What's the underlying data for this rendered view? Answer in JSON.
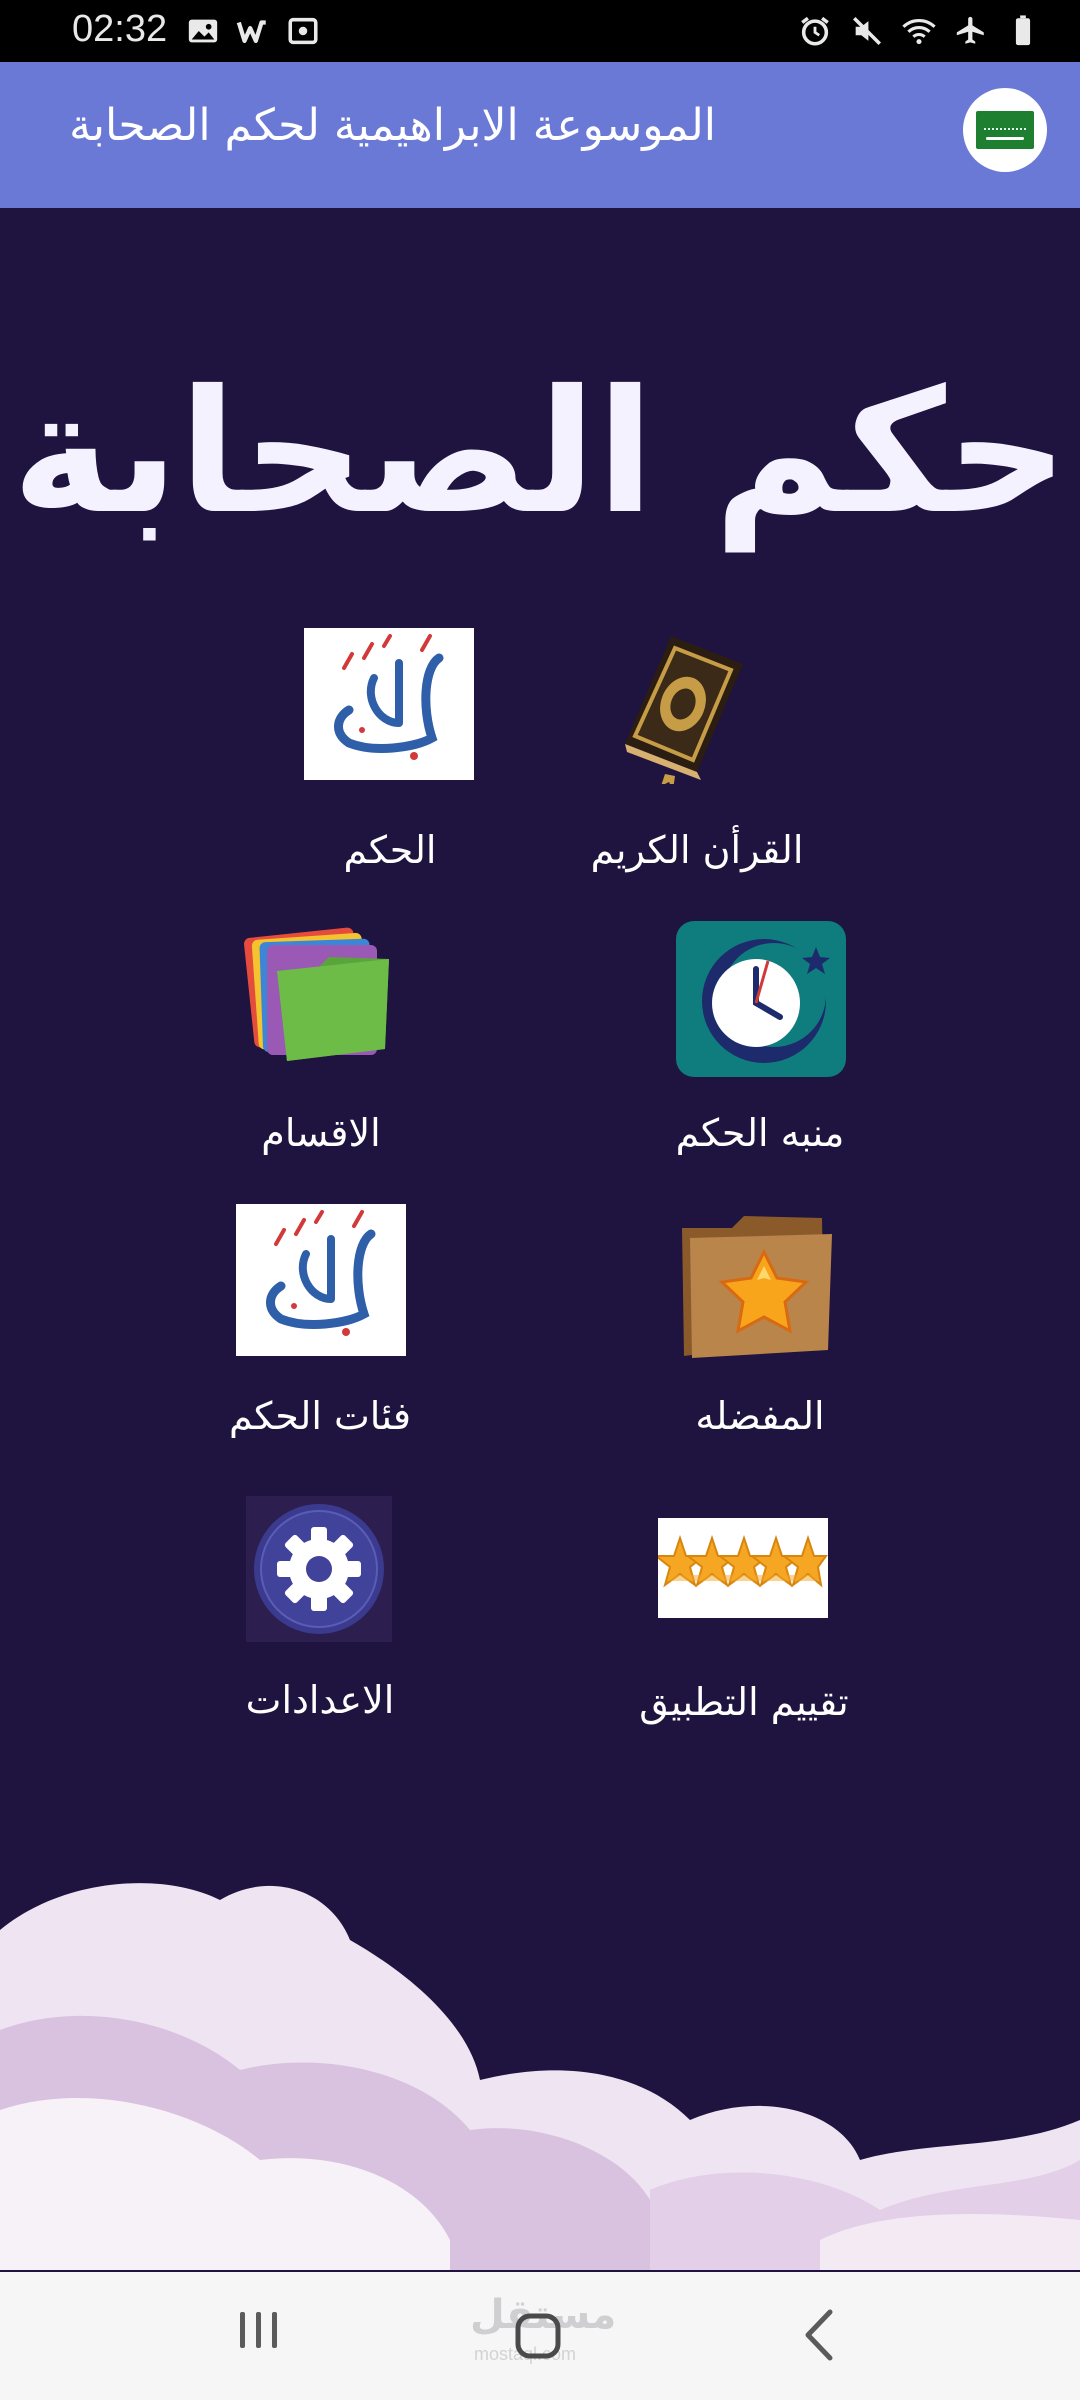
{
  "status_bar": {
    "time": "02:32",
    "left_icons": [
      "image-icon",
      "w-app-icon",
      "cast-icon"
    ],
    "right_icons": [
      "alarm-icon",
      "mute-icon",
      "wifi-icon",
      "airplane-icon",
      "battery-icon"
    ]
  },
  "app_bar": {
    "title": "الموسوعة الابراهيمية لحكم الصحابة",
    "avatar_icon": "saudi-flag-icon"
  },
  "hero": {
    "title": "حكم الصحابة"
  },
  "menu": {
    "items": [
      {
        "label": "الحكم",
        "icon": "calligraphy-icon"
      },
      {
        "label": "القرأن الكريم",
        "icon": "quran-book-icon"
      },
      {
        "label": "الاقسام",
        "icon": "folders-icon"
      },
      {
        "label": "منبه الحكم",
        "icon": "clock-crescent-icon"
      },
      {
        "label": "فئات الحكم",
        "icon": "calligraphy-icon"
      },
      {
        "label": "المفضله",
        "icon": "star-folder-icon"
      },
      {
        "label": "الاعدادات",
        "icon": "gear-icon"
      },
      {
        "label": "تقييم التطبيق",
        "icon": "stars-rating-icon"
      }
    ]
  },
  "nav_bar": {
    "watermark": "مستقل",
    "watermark_sub": "mostaql.com",
    "icons": [
      "recents-icon",
      "home-icon",
      "back-icon"
    ]
  },
  "colors": {
    "background": "#1f1340",
    "app_bar": "#6b79d6",
    "status_bar": "#000000",
    "nav_bar": "#f6f6f7",
    "clouds": "#efe4f1"
  }
}
